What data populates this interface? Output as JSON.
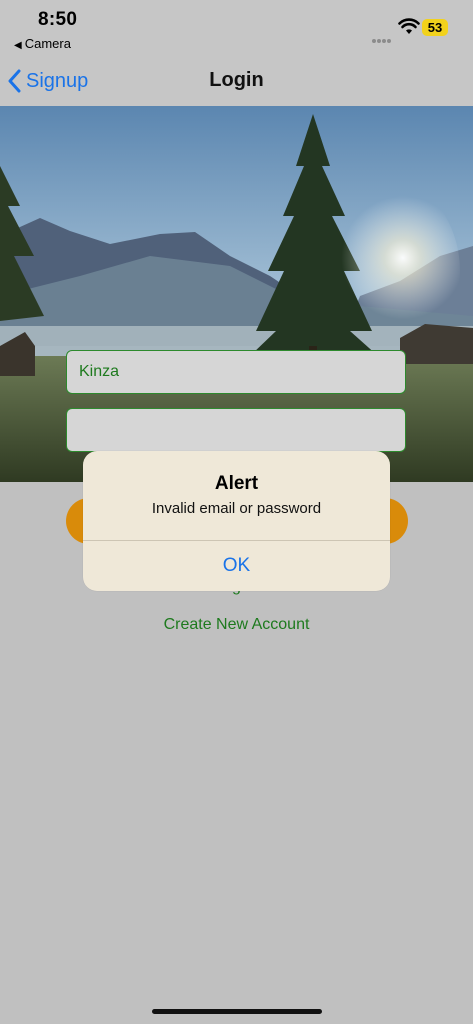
{
  "status_bar": {
    "time": "8:50",
    "back_app": "Camera",
    "battery": "53",
    "battery_color": "#f2d21c"
  },
  "nav": {
    "back_label": "Signup",
    "title": "Login"
  },
  "form": {
    "username_value": "Kinza",
    "password_value": "",
    "login_button_color": "#d98b0a",
    "forgot_label_partial": "g",
    "create_account_label": "Create New Account"
  },
  "alert": {
    "title": "Alert",
    "message": "Invalid email or password",
    "ok_label": "OK"
  },
  "colors": {
    "accent_green": "#1e7a1e",
    "link_blue": "#1a73e8",
    "background": "#c0c0c0"
  }
}
